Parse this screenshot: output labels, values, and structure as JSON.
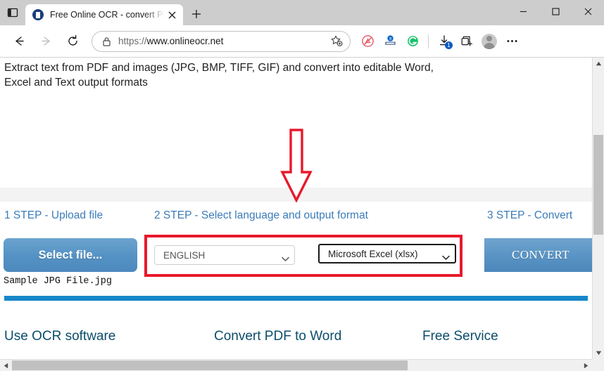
{
  "browser": {
    "tab": {
      "title": "Free Online OCR - convert PDF to",
      "favicon": "onlineocr-favicon",
      "close_label": "×"
    },
    "new_tab_label": "+",
    "window_controls": {
      "minimize": "–",
      "maximize": "☐",
      "close": "✕"
    },
    "nav": {
      "back": "back-arrow",
      "forward": "forward-arrow",
      "refresh": "refresh-arrow"
    },
    "omnibox": {
      "lock": "site-lock-icon",
      "scheme": "https://",
      "host": "www.onlineocr.net",
      "favorite": "add-favorite-star"
    },
    "extensions": [
      {
        "name": "adblock-icon",
        "color": "#e8626d"
      },
      {
        "name": "amazon-assistant-icon",
        "color": "#1168c9"
      },
      {
        "name": "grammarly-icon",
        "color": "#15c26b"
      },
      {
        "name": "downloads-icon",
        "badge": "1"
      },
      {
        "name": "collections-icon"
      },
      {
        "name": "profile-avatar"
      },
      {
        "name": "settings-more-icon"
      }
    ]
  },
  "page": {
    "description": "Extract text from PDF and images (JPG, BMP, TIFF, GIF) and convert into editable Word, Excel and Text output formats",
    "steps": [
      {
        "label": "1 STEP - Upload file"
      },
      {
        "label": "2 STEP - Select language and output format"
      },
      {
        "label": "3 STEP - Convert"
      }
    ],
    "upload": {
      "button_label": "Select file...",
      "filename": "Sample JPG File.jpg"
    },
    "language_select": {
      "value": "ENGLISH"
    },
    "format_select": {
      "value": "Microsoft Excel (xlsx)"
    },
    "convert_button": {
      "label": "CONVERT"
    },
    "bottom_headings": [
      {
        "label": "Use OCR software"
      },
      {
        "label": "Convert PDF to Word"
      },
      {
        "label": "Free Service"
      }
    ]
  },
  "annotations": {
    "arrow": "red-down-arrow",
    "highlight_box": "red-highlight-rectangle",
    "color": "#e8192c"
  },
  "colors": {
    "step_text": "#3b7cb8",
    "heading_text": "#0b4d6b",
    "button_blue": "#5592c4",
    "divider_blue": "#1787c9",
    "annotation_red": "#e8192c"
  }
}
